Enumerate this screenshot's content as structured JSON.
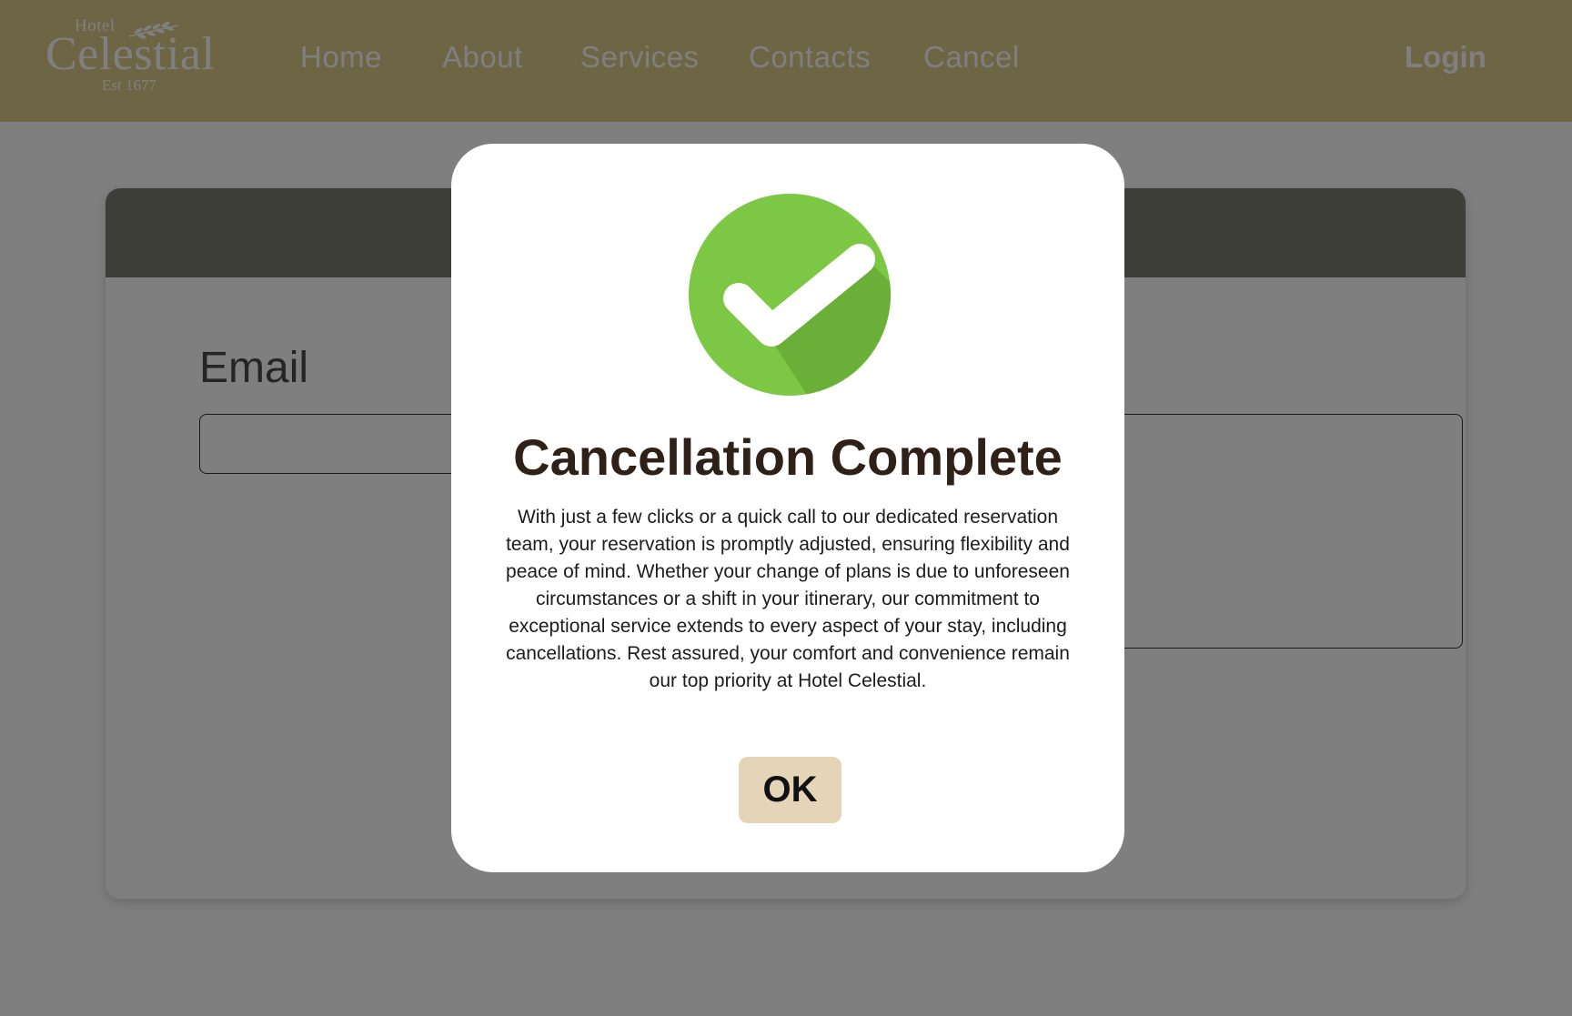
{
  "brand": {
    "hotel_word": "Hotel",
    "name": "Celestial",
    "established": "Est 1677"
  },
  "nav": {
    "items": [
      {
        "label": "Home"
      },
      {
        "label": "About"
      },
      {
        "label": "Services"
      },
      {
        "label": "Contacts"
      },
      {
        "label": "Cancel"
      }
    ],
    "login_label": "Login"
  },
  "form": {
    "email_label": "Email",
    "email_value": "",
    "message_value": ""
  },
  "modal": {
    "icon": "check-circle-icon",
    "title": "Cancellation Complete",
    "body": "With just a few clicks or a quick call to our dedicated reservation team, your reservation is promptly adjusted, ensuring flexibility and peace of mind. Whether your change of plans is due to unforeseen circumstances or a shift in your itinerary, our commitment to exceptional service extends to every aspect of your stay, including cancellations. Rest assured, your comfort and convenience remain our top priority at Hotel Celestial.",
    "ok_label": "OK"
  },
  "colors": {
    "header_bg": "#dccb8b",
    "card_header_bg": "#7b7c6e",
    "check_green": "#7cc845",
    "ok_button_bg": "#e4d4b8",
    "title_color": "#2f2117"
  }
}
